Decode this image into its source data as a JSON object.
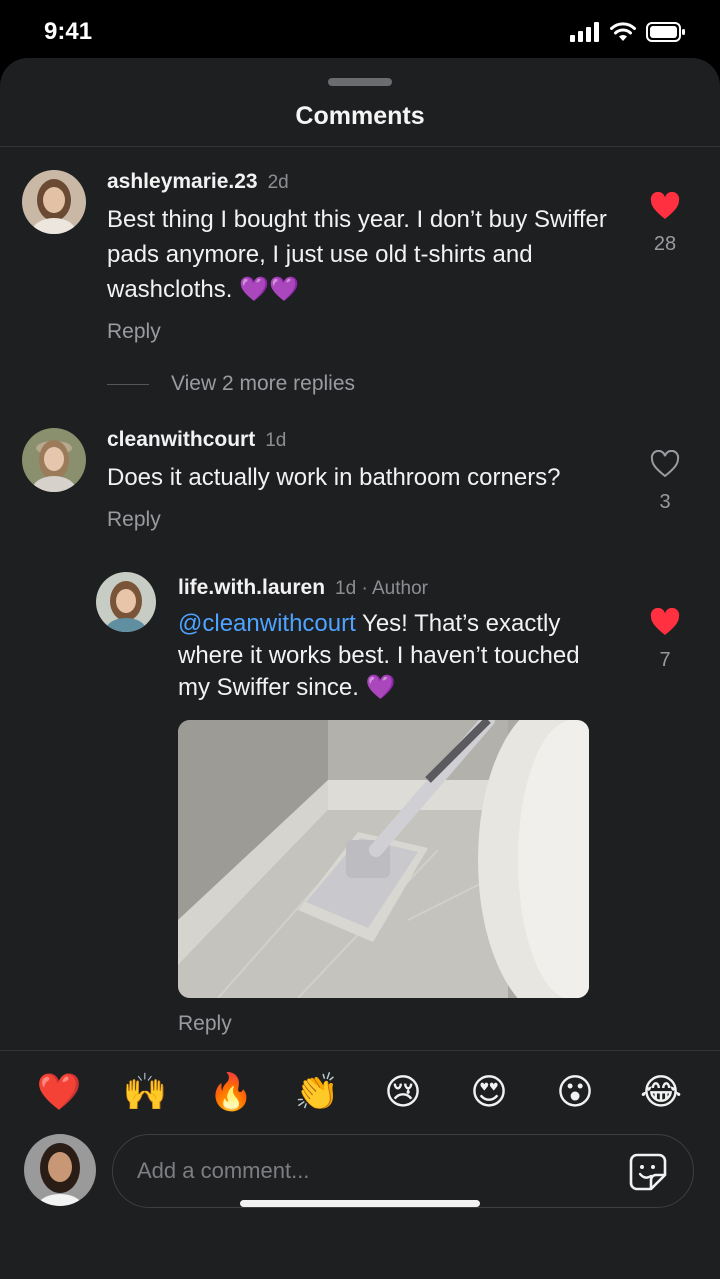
{
  "status_bar": {
    "time": "9:41"
  },
  "sheet": {
    "title": "Comments"
  },
  "comments": [
    {
      "username": "ashleymarie.23",
      "age": "2d",
      "text": "Best thing I bought this year. I don’t buy Swiffer pads anymore, I just use old t-shirts and washcloths. 💜💜",
      "likes": "28",
      "liked": true,
      "reply_label": "Reply",
      "view_replies_label": "View 2 more replies"
    },
    {
      "username": "cleanwithcourt",
      "age": "1d",
      "text": "Does it actually work in bathroom corners?",
      "likes": "3",
      "liked": false,
      "reply_label": "Reply"
    }
  ],
  "reply": {
    "username": "life.with.lauren",
    "meta": "1d · Author",
    "mention": "@cleanwithcourt",
    "text": " Yes! That’s exactly where it works best. I haven’t touched my Swiffer since. 💜",
    "likes": "7",
    "liked": true,
    "reply_label": "Reply"
  },
  "quick_reactions": [
    "❤️",
    "🙌",
    "🔥",
    "👏",
    "😢",
    "😍",
    "😮",
    "😂"
  ],
  "composer": {
    "placeholder": "Add a comment..."
  },
  "colors": {
    "accent_like": "#ff3040",
    "mention": "#4da3ff",
    "sheet_bg": "#1e1f21"
  }
}
